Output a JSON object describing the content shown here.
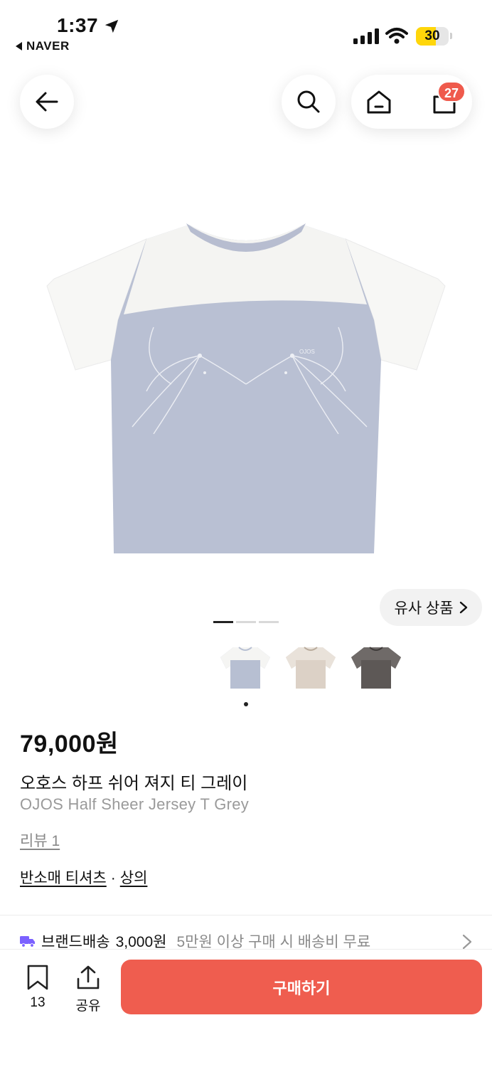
{
  "status_bar": {
    "time": "1:37",
    "back_app": "NAVER",
    "battery": "30"
  },
  "header": {
    "cart_count": "27"
  },
  "gallery": {
    "similar_label": "유사 상품",
    "page_count": 3,
    "active_page": 1
  },
  "colors": {
    "accent": "#ef5d4f",
    "option_grey": "#b7bfd2",
    "option_beige": "#d8ccc0",
    "option_charcoal": "#5f5a58"
  },
  "product": {
    "price": "79,000원",
    "name_ko": "오호스 하프 쉬어 져지 티 그레이",
    "name_en": "OJOS Half Sheer Jersey T Grey",
    "review": "리뷰 1",
    "category_1": "반소매 티셔츠",
    "category_sep": "·",
    "category_2": "상의",
    "print_logo": "OJOS"
  },
  "shipping": {
    "type": "브랜드배송",
    "fee": "3,000원",
    "note": "5만원 이상 구매 시 배송비 무료"
  },
  "bottom": {
    "bookmark_count": "13",
    "share_label": "공유",
    "buy_label": "구매하기"
  }
}
